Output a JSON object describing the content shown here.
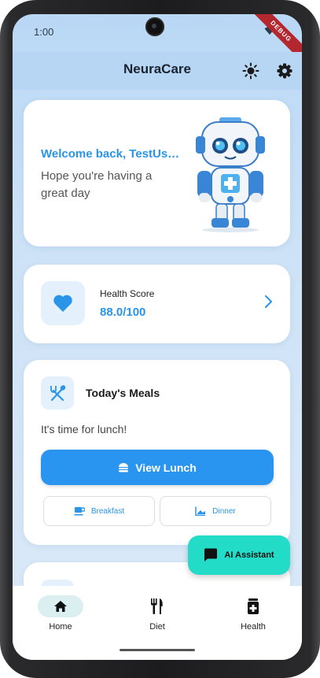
{
  "status_bar": {
    "time": "1:00",
    "debug_banner": "DEBUG"
  },
  "app_bar": {
    "title": "NeuraCare",
    "theme_icon": "sun-icon",
    "settings_icon": "gear-icon"
  },
  "welcome_card": {
    "title": "Welcome back, TestUs…",
    "subtitle": "Hope you're having a great day",
    "illustration": "robot-mascot"
  },
  "health_score_card": {
    "icon": "heart-icon",
    "label": "Health Score",
    "value": "88.0/100"
  },
  "meals_card": {
    "icon": "utensils-icon",
    "title": "Today's Meals",
    "subtitle": "It's time for lunch!",
    "primary_button": "View Lunch",
    "secondary_buttons": [
      {
        "label": "Breakfast",
        "icon": "coffee-icon"
      },
      {
        "label": "Dinner",
        "icon": "dinner-icon"
      }
    ]
  },
  "fab": {
    "label": "AI Assistant",
    "icon": "chat-icon"
  },
  "bottom_nav": {
    "items": [
      {
        "label": "Home",
        "icon": "home-icon",
        "active": true
      },
      {
        "label": "Diet",
        "icon": "fork-knife-icon",
        "active": false
      },
      {
        "label": "Health",
        "icon": "medicine-icon",
        "active": false
      }
    ]
  },
  "colors": {
    "accent": "#2a95e8",
    "app_bar": "#b7d6f4",
    "fab": "#22dcc8",
    "primary_button": "#2a95f0"
  }
}
